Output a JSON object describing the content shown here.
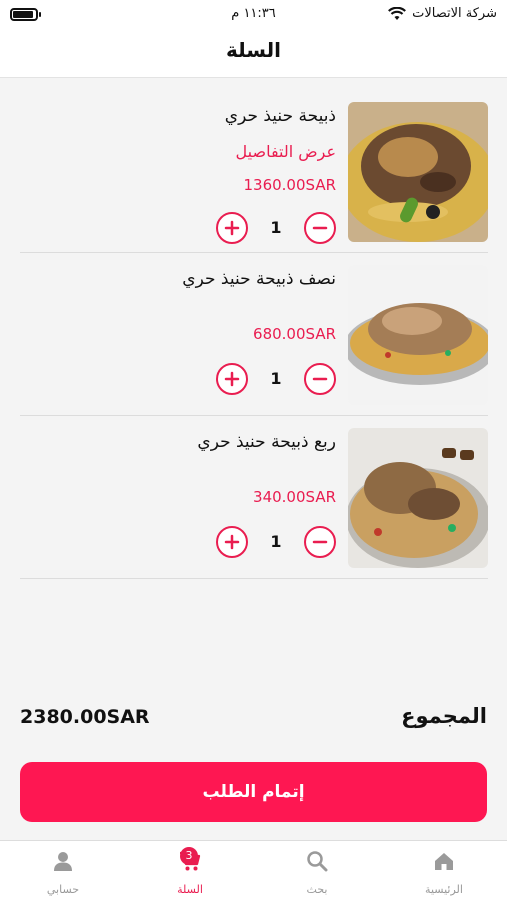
{
  "status_bar": {
    "carrier": "شركة الاتصالات",
    "time": "١١:٣٦ م"
  },
  "header": {
    "title": "السلة"
  },
  "cart": {
    "items": [
      {
        "name": "ذبيحة حنيذ حري",
        "details_link": "عرض التفاصيل",
        "price": "1360.00SAR",
        "quantity": "1"
      },
      {
        "name": "نصف ذبيحة حنيذ حري",
        "price": "680.00SAR",
        "quantity": "1"
      },
      {
        "name": "ربع ذبيحة حنيذ حري",
        "price": "340.00SAR",
        "quantity": "1"
      }
    ]
  },
  "summary": {
    "total_label": "المجموع",
    "total_value": "2380.00SAR"
  },
  "checkout": {
    "label": "إتمام الطلب"
  },
  "tab_bar": {
    "tabs": [
      {
        "label": "الرئيسية",
        "icon": "home-icon"
      },
      {
        "label": "بحث",
        "icon": "search-icon"
      },
      {
        "label": "السلة",
        "icon": "cart-icon",
        "badge": "3",
        "active": true
      },
      {
        "label": "حسابي",
        "icon": "person-icon"
      }
    ]
  },
  "colors": {
    "accent": "#e91d50",
    "button": "#fe1752",
    "inactive_tab": "#999999"
  }
}
